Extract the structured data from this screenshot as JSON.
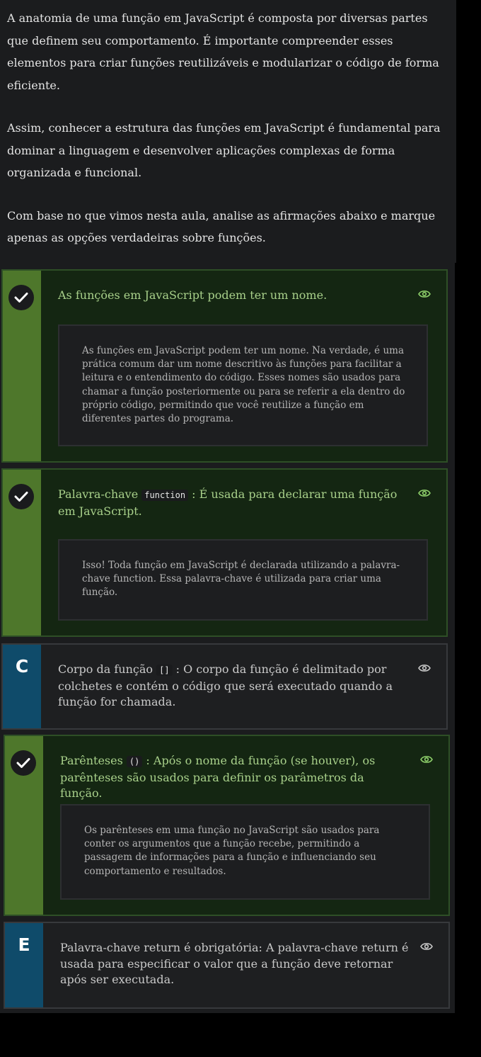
{
  "intro": {
    "paragraphs": [
      "A anatomia de uma função em JavaScript é composta por diversas partes que definem seu comportamento. É importante compreender esses elementos para criar funções reutilizáveis e modularizar o código de forma eficiente.",
      "Assim, conhecer a estrutura das funções em JavaScript é fundamental para dominar a linguagem e desenvolver aplicações complexas de forma organizada e funcional.",
      "Com base no que vimos nesta aula, analise as afirmações abaixo e marque apenas as opções verdadeiras sobre funções."
    ]
  },
  "colors": {
    "correct_bar": "#4e772b",
    "correct_bg": "#142612",
    "neutral_bar": "#0f4b6a",
    "correct_text": "#a8d08a",
    "neutral_text": "#c9c9c9",
    "eye_correct": "#8fd16b",
    "eye_neutral": "#c9c9c9"
  },
  "options": [
    {
      "state": "correct",
      "icon": "check-icon",
      "text": "As funções em JavaScript podem ter um nome.",
      "explanation": "As funções em JavaScript podem ter um nome. Na verdade, é uma prática comum dar um nome descritivo às funções para facilitar a leitura e o entendimento do código. Esses nomes são usados para chamar a função posteriormente ou para se referir a ela dentro do próprio código, permitindo que você reutilize a função em diferentes partes do programa."
    },
    {
      "state": "correct",
      "icon": "check-icon",
      "text_before": "Palavra-chave ",
      "code": "function",
      "text_after": " : É usada para declarar uma função em JavaScript.",
      "explanation": "Isso! Toda função em JavaScript é declarada utilizando a palavra-chave function. Essa palavra-chave é utilizada para criar uma função."
    },
    {
      "state": "neutral",
      "letter": "C",
      "text_before": "Corpo da função ",
      "code": "[]",
      "text_after": " : O corpo da função é delimitado por colchetes e contém o código que será executado quando a função for chamada."
    },
    {
      "state": "correct",
      "icon": "check-icon",
      "text_before": "Parênteses ",
      "code": "()",
      "text_after": " : Após o nome da função (se houver), os parênteses são usados para definir os parâmetros da função.",
      "explanation": "Os parênteses em uma função no JavaScript são usados para conter os argumentos que a função recebe, permitindo a passagem de informações para a função e influenciando seu comportamento e resultados."
    },
    {
      "state": "neutral",
      "letter": "E",
      "text": "Palavra-chave return é obrigatória: A palavra-chave return é usada para especificar o valor que a função deve retornar após ser executada."
    }
  ]
}
